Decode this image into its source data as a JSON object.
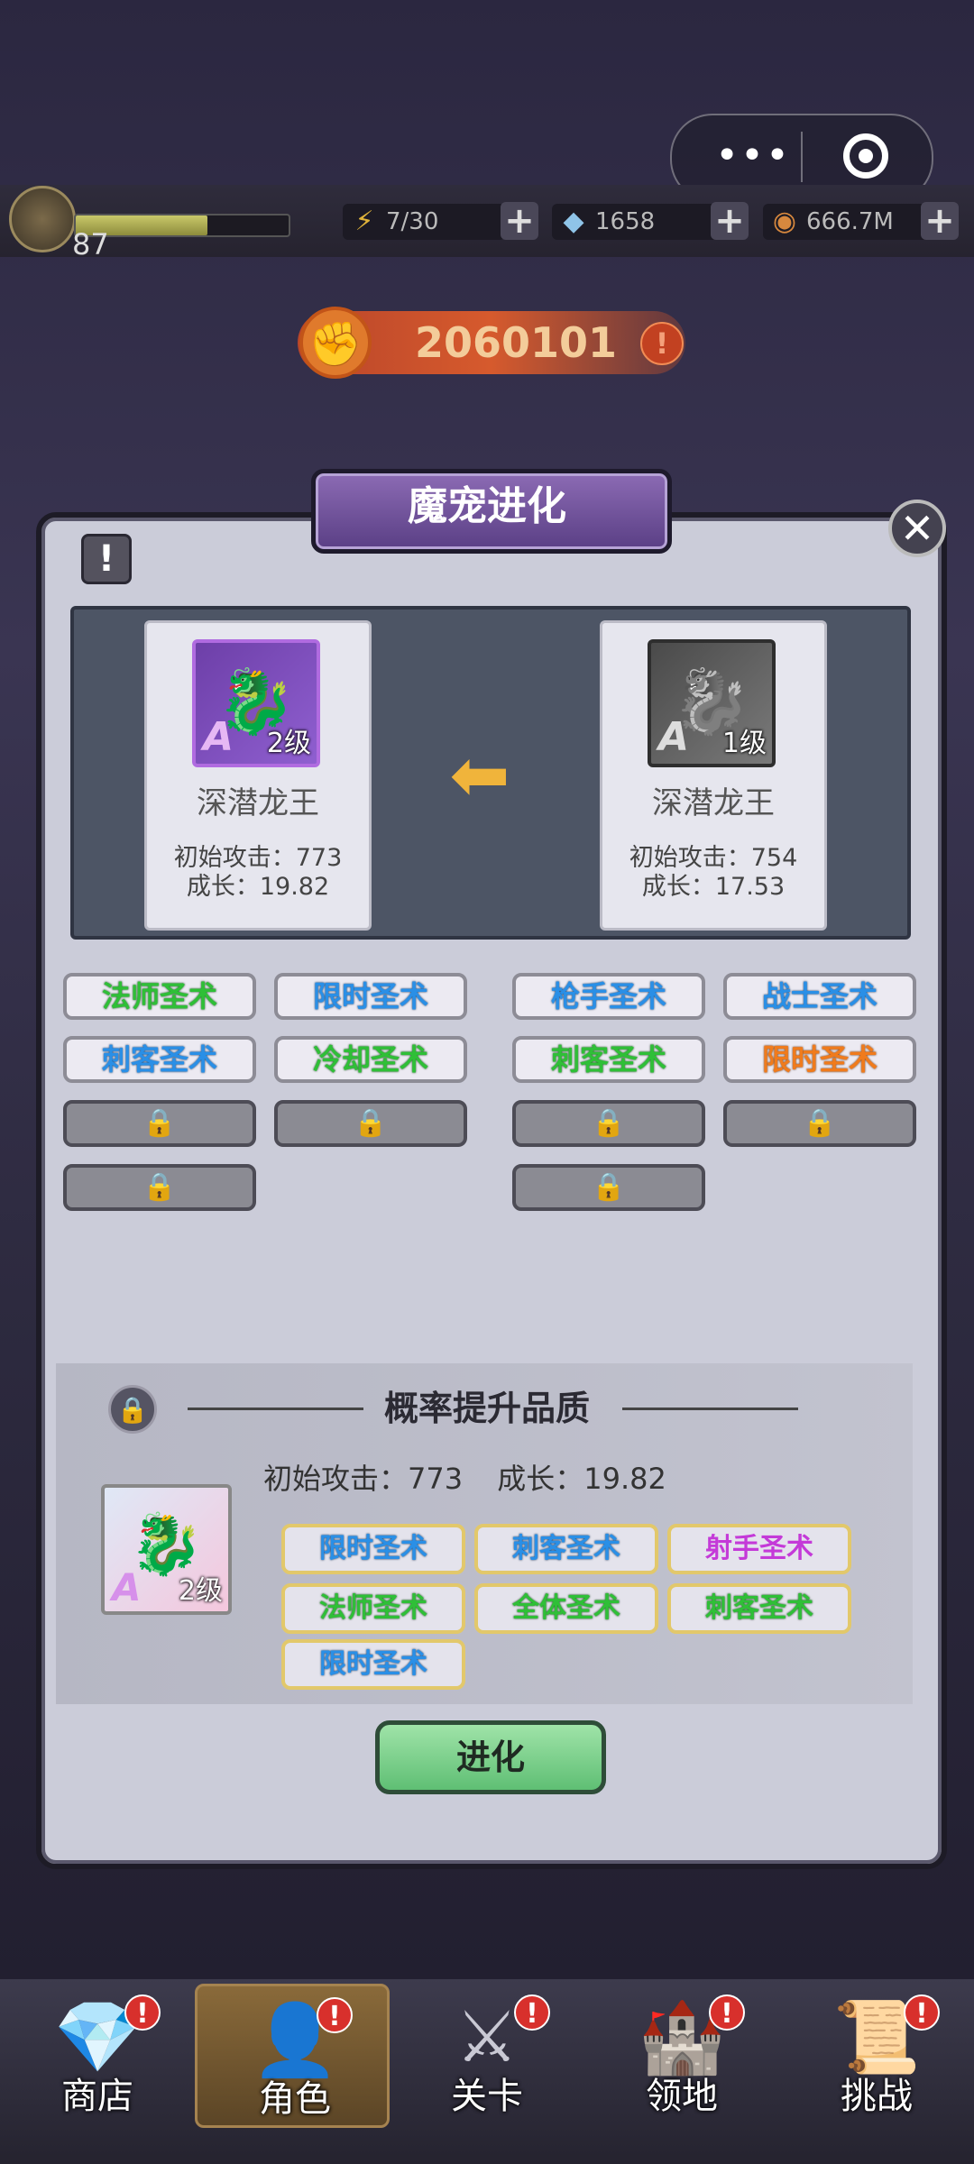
{
  "capsule": {
    "more_glyph": "•••",
    "target_glyph": "◎"
  },
  "player": {
    "level": "87",
    "xp_fraction": 0.62
  },
  "resources": [
    {
      "icon": "lightning-icon",
      "glyph": "⚡",
      "value": "7/30"
    },
    {
      "icon": "crystal-icon",
      "glyph": "◆",
      "value": "1658"
    },
    {
      "icon": "coin-icon",
      "glyph": "◉",
      "value": "666.7M"
    }
  ],
  "plus_glyph": "+",
  "power": {
    "value": "2060101",
    "icon_glyph": "✊",
    "alert": "!"
  },
  "panel": {
    "title": "魔宠进化",
    "close_glyph": "✕",
    "info_glyph": "!",
    "arrow_glyph": "⬅",
    "result_pet": {
      "name": "深潜龙王",
      "grade": "A",
      "level": "2级",
      "attack": "初始攻击：773",
      "growth": "成长：19.82"
    },
    "source_pet": {
      "name": "深潜龙王",
      "grade": "A",
      "level": "1级",
      "attack": "初始攻击：754",
      "growth": "成长：17.53"
    },
    "result_skills": [
      {
        "label": "法师圣术",
        "color": "green"
      },
      {
        "label": "限时圣术",
        "color": "blue"
      },
      {
        "label": "刺客圣术",
        "color": "blue"
      },
      {
        "label": "冷却圣术",
        "color": "green"
      }
    ],
    "source_skills": [
      {
        "label": "枪手圣术",
        "color": "blue"
      },
      {
        "label": "战士圣术",
        "color": "blue"
      },
      {
        "label": "刺客圣术",
        "color": "green"
      },
      {
        "label": "限时圣术",
        "color": "orange"
      }
    ],
    "lock_glyph": "🔒",
    "upgrade": {
      "title": "概率提升品质",
      "attack": "初始攻击：773",
      "growth": "成长：19.82",
      "pet": {
        "grade": "A",
        "level": "2级"
      },
      "slots": [
        {
          "label": "限时圣术",
          "color": "blue"
        },
        {
          "label": "刺客圣术",
          "color": "blue"
        },
        {
          "label": "射手圣术",
          "color": "magenta"
        },
        {
          "label": "法师圣术",
          "color": "green"
        },
        {
          "label": "全体圣术",
          "color": "green"
        },
        {
          "label": "刺客圣术",
          "color": "green"
        },
        {
          "label": "限时圣术",
          "color": "blue"
        }
      ]
    },
    "evolve_label": "进化"
  },
  "nav": [
    {
      "label": "商店",
      "icon": "shop-icon",
      "glyph": "💎",
      "badge": "!",
      "active": false
    },
    {
      "label": "角色",
      "icon": "character-icon",
      "glyph": "👤",
      "badge": "!",
      "active": true
    },
    {
      "label": "关卡",
      "icon": "crossed-swords-icon",
      "glyph": "⚔",
      "badge": "!",
      "active": false
    },
    {
      "label": "领地",
      "icon": "castle-icon",
      "glyph": "🏰",
      "badge": "!",
      "active": false
    },
    {
      "label": "挑战",
      "icon": "scroll-icon",
      "glyph": "📜",
      "badge": "!",
      "active": false
    }
  ],
  "colors": {
    "green": "#2fbf37",
    "blue": "#2a8fe6",
    "orange": "#f07b1c",
    "magenta": "#c43ad8",
    "accent": "#8c6bb4"
  }
}
